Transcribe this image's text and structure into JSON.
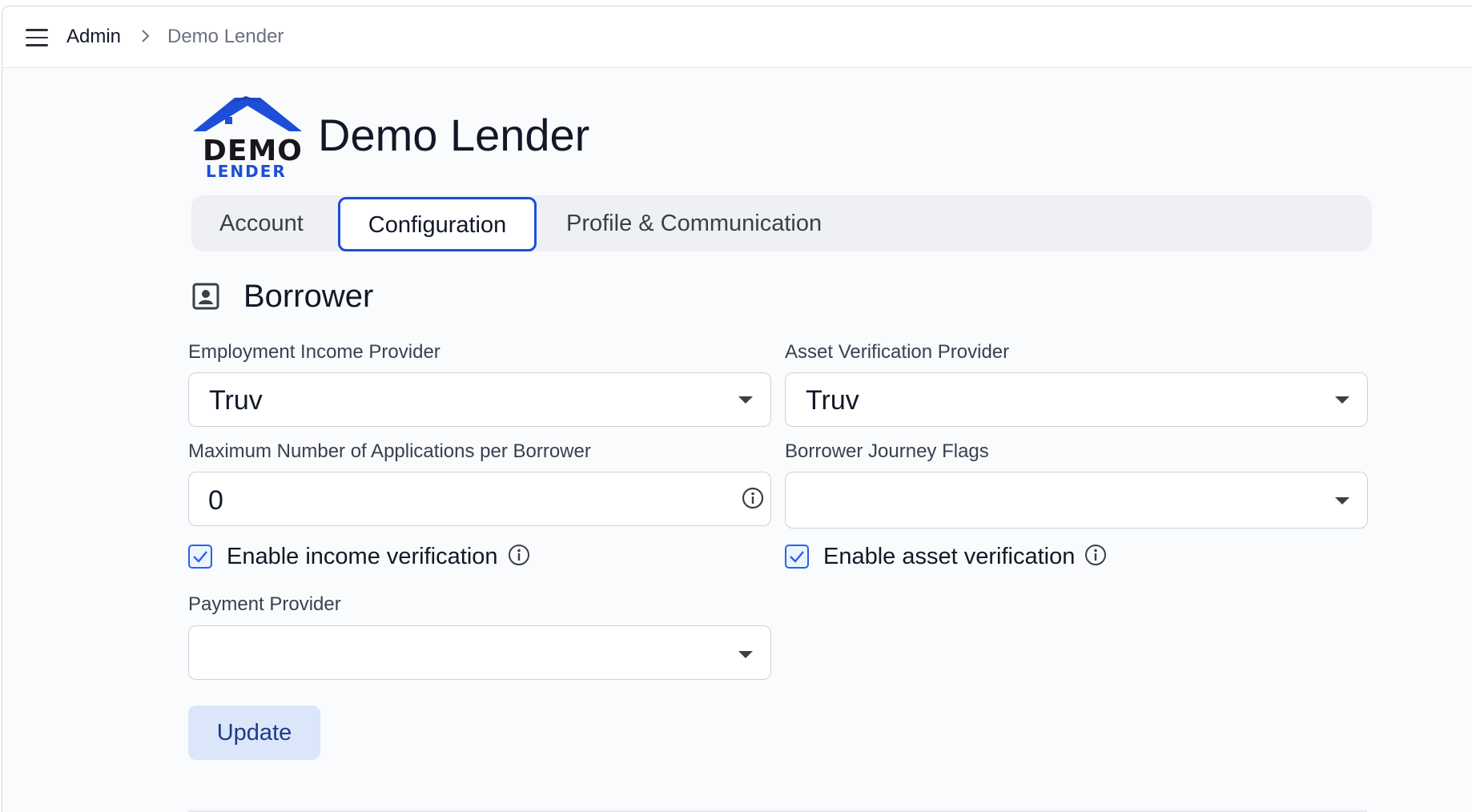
{
  "breadcrumb": {
    "root": "Admin",
    "current": "Demo Lender"
  },
  "logo": {
    "line1": "DEMO",
    "line2": "LENDER"
  },
  "org": {
    "title": "Demo Lender"
  },
  "tabs": [
    {
      "label": "Account",
      "active": false
    },
    {
      "label": "Configuration",
      "active": true
    },
    {
      "label": "Profile & Communication",
      "active": false
    }
  ],
  "section": {
    "title": "Borrower",
    "icon": "contact-card-icon"
  },
  "form": {
    "employment_income_provider": {
      "label": "Employment Income Provider",
      "value": "Truv"
    },
    "asset_verification_provider": {
      "label": "Asset Verification Provider",
      "value": "Truv"
    },
    "max_applications": {
      "label": "Maximum Number of Applications per Borrower",
      "value": "0"
    },
    "borrower_journey_flags": {
      "label": "Borrower Journey Flags",
      "value": ""
    },
    "enable_income_verification": {
      "label": "Enable income verification",
      "checked": true
    },
    "enable_asset_verification": {
      "label": "Enable asset verification",
      "checked": true
    },
    "payment_provider": {
      "label": "Payment Provider",
      "value": ""
    }
  },
  "actions": {
    "update_label": "Update"
  },
  "colors": {
    "accent": "#1d4ed8",
    "button_bg": "#dbe6fa",
    "button_text": "#1e3a8a"
  }
}
